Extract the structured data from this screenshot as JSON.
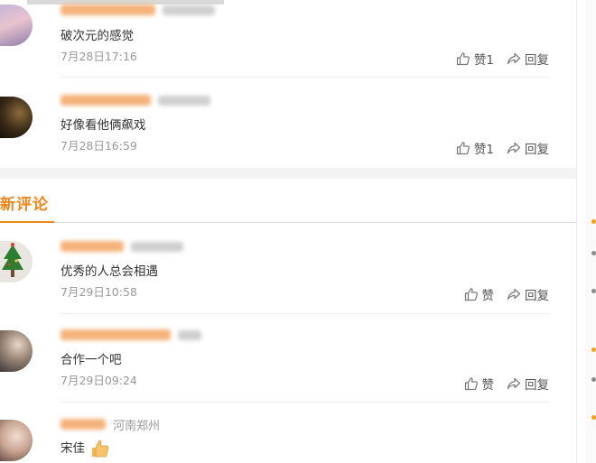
{
  "hot_comments": [
    {
      "text": "破次元的感觉",
      "time": "7月28日17:16",
      "like_label": "赞1",
      "reply_label": "回复"
    },
    {
      "text": "好像看他俩飙戏",
      "time": "7月28日16:59",
      "like_label": "赞1",
      "reply_label": "回复"
    }
  ],
  "new_section": {
    "title": "新评论"
  },
  "new_comments": [
    {
      "text": "优秀的人总会相遇",
      "time": "7月29日10:58",
      "like_label": "赞",
      "reply_label": "回复"
    },
    {
      "text": "合作一个吧",
      "time": "7月29日09:24",
      "like_label": "赞",
      "reply_label": "回复"
    },
    {
      "location": "河南郑州",
      "text": "宋佳"
    }
  ],
  "colors": {
    "accent": "#f08519",
    "username_blur": "#f5b27a",
    "muted": "#999999"
  },
  "icons": [
    "thumbs-up-icon",
    "share-arrow-icon",
    "thumbs-up-emoji-icon"
  ]
}
